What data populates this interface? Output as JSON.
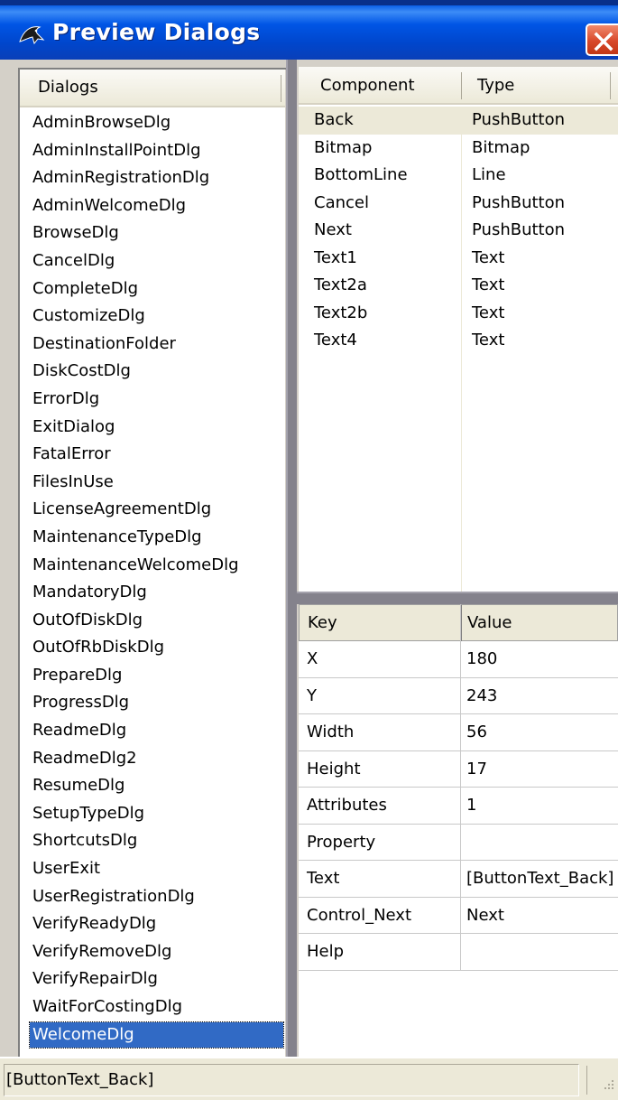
{
  "window": {
    "title": "Preview Dialogs"
  },
  "dialogs": {
    "header": "Dialogs",
    "items": [
      "AdminBrowseDlg",
      "AdminInstallPointDlg",
      "AdminRegistrationDlg",
      "AdminWelcomeDlg",
      "BrowseDlg",
      "CancelDlg",
      "CompleteDlg",
      "CustomizeDlg",
      "DestinationFolder",
      "DiskCostDlg",
      "ErrorDlg",
      "ExitDialog",
      "FatalError",
      "FilesInUse",
      "LicenseAgreementDlg",
      "MaintenanceTypeDlg",
      "MaintenanceWelcomeDlg",
      "MandatoryDlg",
      "OutOfDiskDlg",
      "OutOfRbDiskDlg",
      "PrepareDlg",
      "ProgressDlg",
      "ReadmeDlg",
      "ReadmeDlg2",
      "ResumeDlg",
      "SetupTypeDlg",
      "ShortcutsDlg",
      "UserExit",
      "UserRegistrationDlg",
      "VerifyReadyDlg",
      "VerifyRemoveDlg",
      "VerifyRepairDlg",
      "WaitForCostingDlg",
      "WelcomeDlg"
    ],
    "selected": "WelcomeDlg"
  },
  "components": {
    "headers": {
      "component": "Component",
      "type": "Type"
    },
    "rows": [
      {
        "component": "Back",
        "type": "PushButton"
      },
      {
        "component": "Bitmap",
        "type": "Bitmap"
      },
      {
        "component": "BottomLine",
        "type": "Line"
      },
      {
        "component": "Cancel",
        "type": "PushButton"
      },
      {
        "component": "Next",
        "type": "PushButton"
      },
      {
        "component": "Text1",
        "type": "Text"
      },
      {
        "component": "Text2a",
        "type": "Text"
      },
      {
        "component": "Text2b",
        "type": "Text"
      },
      {
        "component": "Text4",
        "type": "Text"
      }
    ],
    "selected": "Back"
  },
  "properties": {
    "headers": {
      "key": "Key",
      "value": "Value"
    },
    "rows": [
      {
        "key": "X",
        "value": "180"
      },
      {
        "key": "Y",
        "value": "243"
      },
      {
        "key": "Width",
        "value": "56"
      },
      {
        "key": "Height",
        "value": "17"
      },
      {
        "key": "Attributes",
        "value": "1"
      },
      {
        "key": "Property",
        "value": ""
      },
      {
        "key": "Text",
        "value": "[ButtonText_Back]"
      },
      {
        "key": "Control_Next",
        "value": "Next"
      },
      {
        "key": "Help",
        "value": ""
      }
    ]
  },
  "status": {
    "text": "[ButtonText_Back]"
  },
  "icons": {
    "app": "dolphin-icon",
    "close": "close-icon",
    "grip": "resize-grip-icon"
  },
  "colors": {
    "titlebar": "#0055e5",
    "selection": "#316ac5",
    "close": "#d8482a"
  }
}
